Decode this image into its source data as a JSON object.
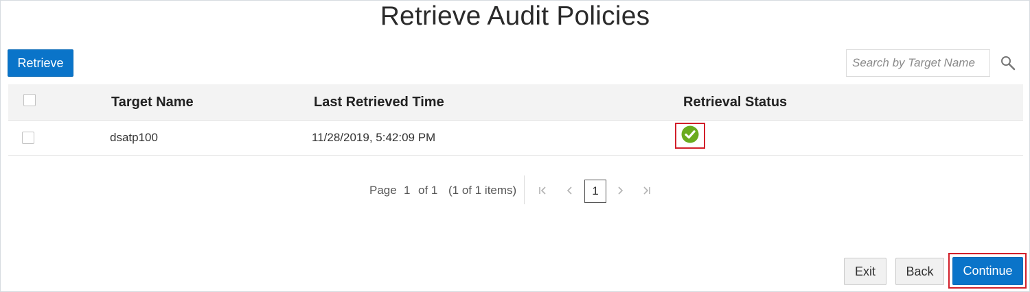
{
  "page": {
    "title": "Retrieve Audit Policies"
  },
  "toolbar": {
    "retrieve_label": "Retrieve",
    "search_placeholder": "Search by Target Name",
    "search_value": "",
    "search_icon": "search-icon"
  },
  "table": {
    "columns": [
      "",
      "Target Name",
      "Last Retrieved Time",
      "Retrieval Status"
    ],
    "rows": [
      {
        "selected": false,
        "target_name": "dsatp100",
        "last_retrieved_time": "11/28/2019, 5:42:09 PM",
        "retrieval_status": "success",
        "status_icon": "check-circle-icon"
      }
    ]
  },
  "pagination": {
    "page_label": "Page",
    "current_page": "1",
    "of_label": "of 1",
    "items_label": "(1 of 1 items)",
    "page_button": "1",
    "icons": [
      "first-page-icon",
      "previous-page-icon",
      "next-page-icon",
      "last-page-icon"
    ]
  },
  "footer": {
    "exit_label": "Exit",
    "back_label": "Back",
    "continue_label": "Continue"
  },
  "colors": {
    "primary": "#0a74c9",
    "success": "#6aab1e",
    "highlight": "#d21f2a",
    "header_bg": "#f3f3f3"
  }
}
